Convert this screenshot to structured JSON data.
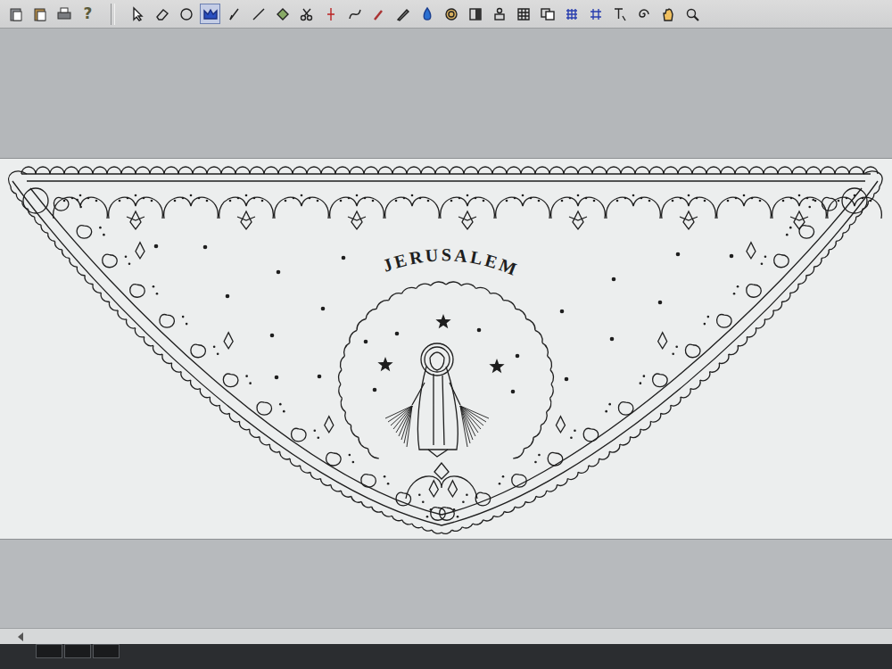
{
  "toolbar": {
    "help": "?",
    "tools": [
      {
        "selected": false
      },
      {
        "selected": false
      },
      {
        "selected": false
      },
      {
        "selected": true
      },
      {
        "selected": false
      },
      {
        "selected": false
      },
      {
        "selected": false
      },
      {
        "selected": false
      },
      {
        "selected": false
      },
      {
        "selected": false
      },
      {
        "selected": false
      },
      {
        "selected": false
      },
      {
        "selected": false
      },
      {
        "selected": false
      },
      {
        "selected": false
      },
      {
        "selected": false
      },
      {
        "selected": false
      },
      {
        "selected": false
      },
      {
        "selected": false
      },
      {
        "selected": false
      },
      {
        "selected": false
      },
      {
        "selected": false
      },
      {
        "selected": false
      },
      {
        "selected": false
      }
    ]
  },
  "design": {
    "title": "JERUSALEM"
  }
}
